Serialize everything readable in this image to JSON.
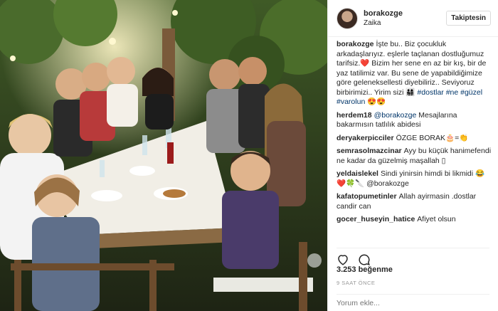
{
  "post": {
    "username": "borakozge",
    "location": "Zaika",
    "follow_label": "Takiptesin",
    "likes": "3.253 beğenme",
    "time": "9 SAAT ÖNCE",
    "comment_placeholder": "Yorum ekle..."
  },
  "caption": {
    "user": "borakozge",
    "text": "İşte bu.. Biz çocukluk arkadaşlarıyız. eşlerle taçlanan dostluğumuz tarifsiz.❤️ Bizim her sene en az bir kış, bir de yaz tatilimiz var. Bu sene de yapabildiğimize göre geleneksellesti diyebiliriz.. Seviyoruz birbirimizi.. Yirim sizi 👨‍👩‍👧‍👦 ",
    "tags": "#dostlar #ne #güzel #varolun",
    "emoji": " 😍😍"
  },
  "comments": [
    {
      "user": "herdem18",
      "mention": "@borakozge",
      "text": " Mesajlarına bakarmısın tatlılık abidesi"
    },
    {
      "user": "deryakerpicciler",
      "mention": "",
      "text": "ÖZGE BORAK🎂=👏"
    },
    {
      "user": "semrasolmazcinar",
      "mention": "",
      "text": "Ayy bu küçük hanimefendi ne kadar da güzelmiş maşallah ▯"
    },
    {
      "user": "yeldaislekel",
      "mention": "",
      "text": "Sindi yinirsin himdi bi likmidi 😂❤️🍀🔪 @borakozge"
    },
    {
      "user": "kafatopumetinler",
      "mention": "",
      "text": "Allah ayirmasin .dostlar candir can"
    },
    {
      "user": "gocer_huseyin_hatice",
      "mention": "",
      "text": "Afiyet olsun"
    }
  ],
  "icons": {
    "like": "heart-icon",
    "comment": "speech-bubble-icon"
  },
  "colors": {
    "link": "#003569",
    "border": "#efefef"
  }
}
